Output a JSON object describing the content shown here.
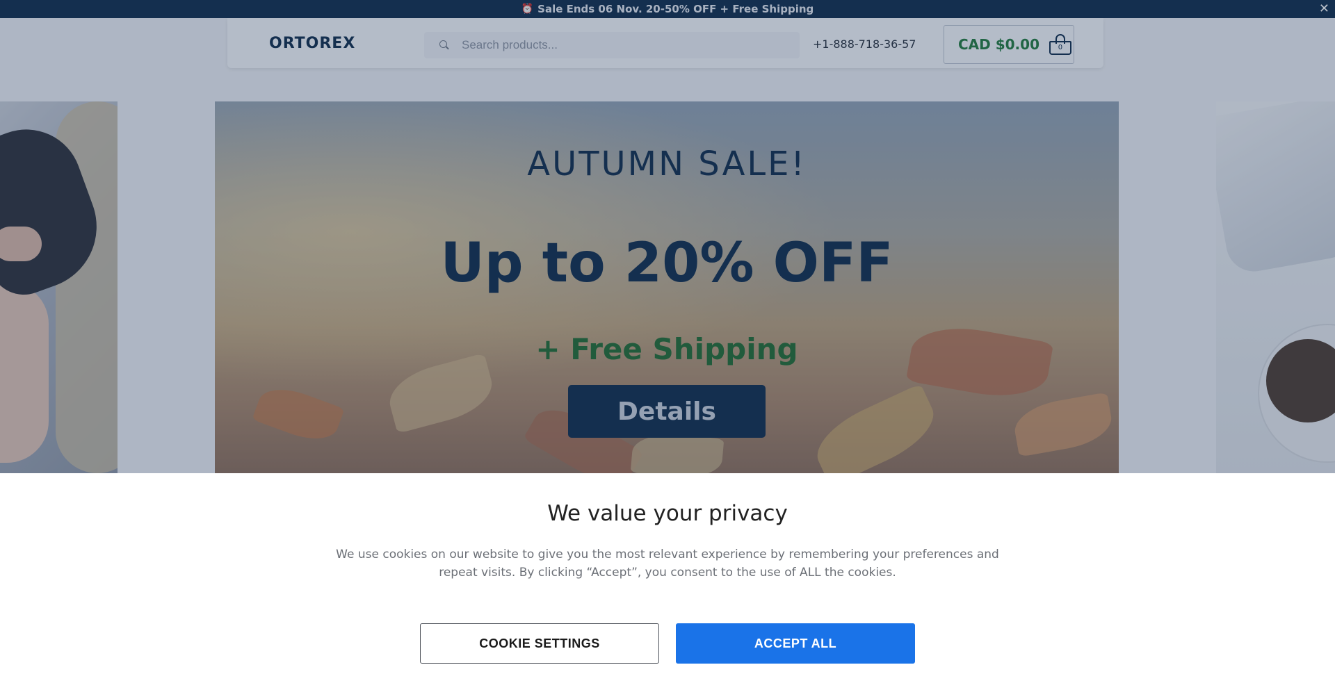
{
  "announcement": {
    "icon": "alarm-clock-icon",
    "text": "Sale Ends 06 Nov. 20-50% OFF + Free Shipping",
    "close_icon": "close-icon",
    "close_symbol": "✕"
  },
  "header": {
    "logo": "ORTOREX",
    "search": {
      "placeholder": "Search products...",
      "value": "",
      "icon": "search-icon"
    },
    "phone": "+1-888-718-36-57",
    "cart": {
      "amount": "CAD $0.00",
      "count": "0",
      "icon": "shopping-bag-icon"
    }
  },
  "hero": {
    "kicker": "AUTUMN SALE!",
    "headline": "Up to 20% OFF",
    "subheadline": "+ Free Shipping",
    "button_label": "Details"
  },
  "cookie_banner": {
    "title": "We value your privacy",
    "text": "We use cookies on our website to give you the most relevant experience by remembering your preferences and repeat visits. By clicking “Accept”, you consent to the use of ALL the cookies.",
    "settings_label": "COOKIE SETTINGS",
    "accept_label": "ACCEPT ALL"
  },
  "colors": {
    "brand_navy": "#0b2a4a",
    "price_green": "#1e7a3c",
    "accept_blue": "#1a73e8"
  }
}
